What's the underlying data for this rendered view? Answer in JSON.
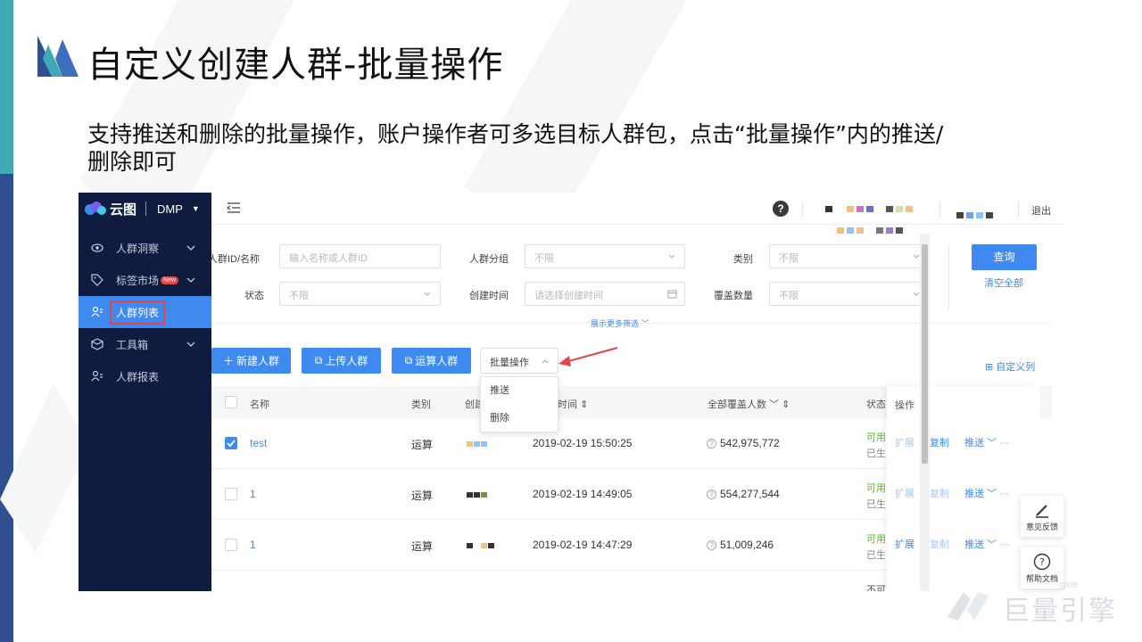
{
  "slide": {
    "title": "自定义创建人群-批量操作",
    "description": "支持推送和删除的批量操作，账户操作者可多选目标人群包，点击“批量操作”内的推送/删除即可",
    "watermark": "巨量引擎",
    "watermark_small": "gine"
  },
  "app": {
    "brand": "云图",
    "product": "DMP",
    "logout": "退出",
    "help": "?",
    "sidebar": [
      {
        "label": "人群洞察",
        "icon": "eye-icon",
        "expandable": true
      },
      {
        "label": "标签市场",
        "icon": "tag-icon",
        "expandable": true,
        "badge": "New"
      },
      {
        "label": "人群列表",
        "icon": "users-icon",
        "active": true
      },
      {
        "label": "工具箱",
        "icon": "box-icon",
        "expandable": true
      },
      {
        "label": "人群报表",
        "icon": "report-icon"
      }
    ],
    "colors": {
      "accent": "#3e8af0",
      "sidebar": "#0f1c3f",
      "highlight": "#e04848",
      "success": "#52c41a"
    }
  },
  "filters": {
    "id_name": {
      "label": "人群ID/名称",
      "placeholder": "输入名称或人群ID"
    },
    "group": {
      "label": "人群分组",
      "value": "不限"
    },
    "category": {
      "label": "类别",
      "value": "不限"
    },
    "status": {
      "label": "状态",
      "value": "不限"
    },
    "create_time": {
      "label": "创建时间",
      "placeholder": "请选择创建时间"
    },
    "coverage": {
      "label": "覆盖数量",
      "value": "不限"
    },
    "query_button": "查询",
    "clear_all": "清空全部",
    "more": "展示更多筛选"
  },
  "toolbar": {
    "new_crowd": "新建人群",
    "upload_crowd": "上传人群",
    "compute_crowd": "运算人群",
    "batch": "批量操作",
    "custom_columns": "自定义列",
    "batch_menu": [
      "推送",
      "删除"
    ]
  },
  "table": {
    "headers": {
      "name": "名称",
      "category": "类别",
      "creator": "创建",
      "time": "时间",
      "coverage": "全部覆盖人数",
      "status": "状态",
      "ops": "操作"
    },
    "rows": [
      {
        "name": "test",
        "category": "运算",
        "created": "2019-02-19 15:50:25",
        "coverage": "542,975,772",
        "status": "可用",
        "status2": "已生",
        "checked": true,
        "swatches": [
          "#f1c27d",
          "#8fc3f2",
          "#8fc3f2"
        ]
      },
      {
        "name": "1",
        "category": "运算",
        "created": "2019-02-19 14:49:05",
        "coverage": "554,277,544",
        "status": "可用",
        "status2": "已生",
        "checked": false,
        "swatches": [
          "#333333",
          "#333333",
          "#8a8a3a"
        ]
      },
      {
        "name": "1",
        "category": "运算",
        "created": "2019-02-19 14:47:29",
        "coverage": "51,009,246",
        "status": "可用",
        "status2": "已生",
        "checked": false,
        "swatches": [
          "#333333",
          "#ffffff",
          "#f1c27d",
          "#333333"
        ]
      }
    ],
    "row_ops": {
      "expand": "扩展",
      "copy": "复制",
      "push": "推送",
      "more": "···"
    },
    "partial_status": "不可"
  },
  "floating": {
    "feedback": "意见反馈",
    "docs": "帮助文档"
  }
}
